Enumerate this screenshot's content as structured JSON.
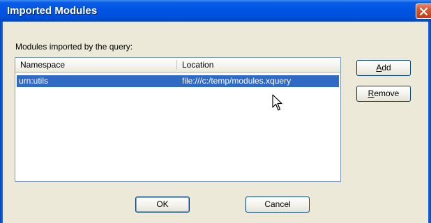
{
  "window": {
    "title": "Imported Modules"
  },
  "group_label": "Modules imported by the query:",
  "list": {
    "columns": [
      "Namespace",
      "Location"
    ],
    "rows": [
      {
        "namespace": "urn:utils",
        "location": "file:///c:/temp/modules.xquery",
        "selected": true
      }
    ]
  },
  "buttons": {
    "add": "Add",
    "remove": "Remove",
    "ok": "OK",
    "cancel": "Cancel"
  },
  "colors": {
    "title_bar": "#0054e3",
    "selection": "#316ac5",
    "dialog_bg": "#ece9d8",
    "close_button": "#d8552d"
  },
  "icons": {
    "close": "close-icon",
    "cursor": "mouse-pointer-icon"
  }
}
